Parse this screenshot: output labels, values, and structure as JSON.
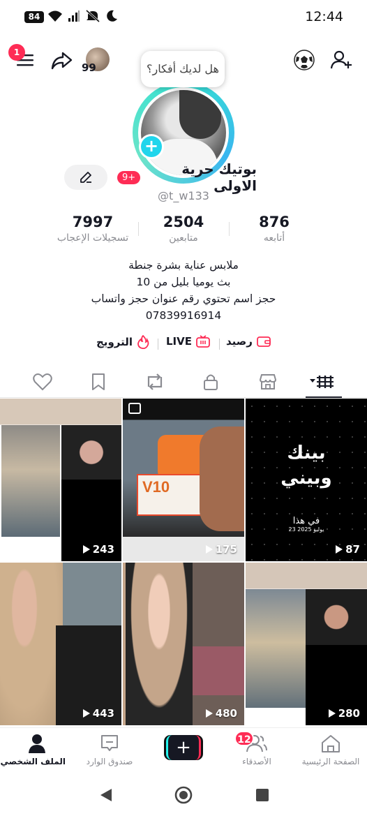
{
  "status_bar": {
    "battery": "84",
    "time": "12:44"
  },
  "topbar": {
    "menu_badge": "1",
    "visitors_count": "99"
  },
  "profile": {
    "bubble_text": "هل لديك أفكار؟",
    "name": "بوتيك حرية الاولى",
    "notif_badge": "9+",
    "handle": "@t_w133",
    "stats": [
      {
        "value": "7997",
        "label": "تسجيلات الإعجاب"
      },
      {
        "value": "2504",
        "label": "متابعين"
      },
      {
        "value": "876",
        "label": "أتابعه"
      }
    ],
    "bio": [
      "ملابس عناية بشرة جنطة",
      "بث يوميا بليل من 10",
      "حجز اسم تحتوي رقم عنوان حجز واتساب",
      "07839916914"
    ]
  },
  "links": {
    "promote": "الترويج",
    "live": "LIVE",
    "balance": "رصيد"
  },
  "videos": [
    {
      "views": "243"
    },
    {
      "views": "175"
    },
    {
      "views": "87",
      "overlay_line1": "بينك",
      "overlay_line2": "وبيني",
      "overlay_line3": "في هذا",
      "overlay_date": "23 يوليو 2025"
    },
    {
      "views": "443"
    },
    {
      "views": "480"
    },
    {
      "views": "280"
    }
  ],
  "product_label": "V10",
  "bottom_nav": {
    "profile": "الملف الشخصي",
    "inbox": "صندوق الوارد",
    "friends": "الأصدقاء",
    "friends_badge": "12",
    "home": "الصفحة الرئيسية"
  },
  "colors": {
    "accent": "#fe2c55",
    "teal": "#20d5ec"
  }
}
